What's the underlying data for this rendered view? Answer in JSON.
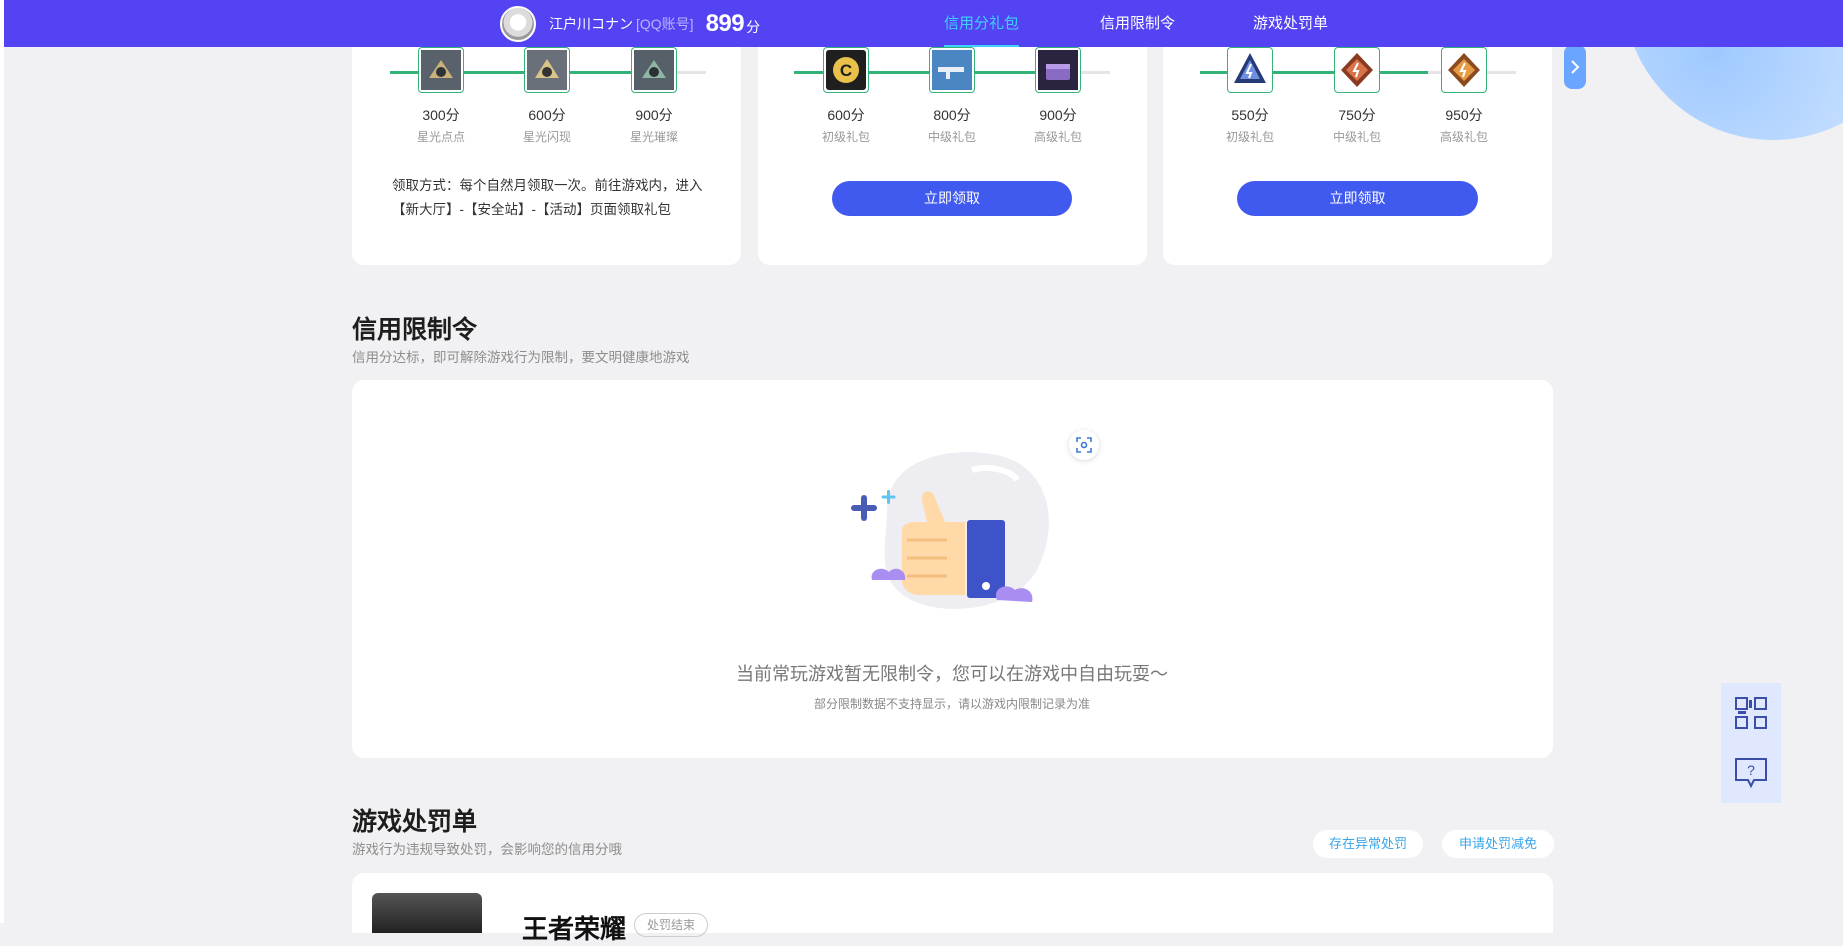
{
  "header": {
    "username": "江户川コナン",
    "account_type": "[QQ账号]",
    "score": "899",
    "score_unit": "分",
    "tabs": [
      {
        "label": "信用分礼包",
        "active": true
      },
      {
        "label": "信用限制令",
        "active": false
      },
      {
        "label": "游戏处罚单",
        "active": false
      }
    ]
  },
  "gift_cards": [
    {
      "progress": 0.85,
      "rewards": [
        {
          "points": "300分",
          "name": "星光点点",
          "icon": "drone-icon"
        },
        {
          "points": "600分",
          "name": "星光闪现",
          "icon": "drone-icon"
        },
        {
          "points": "900分",
          "name": "星光璀璨",
          "icon": "drone-icon"
        }
      ],
      "note": "领取方式：每个自然月领取一次。前往游戏内，进入【新大厅】-【安全站】-【活动】页面领取礼包"
    },
    {
      "progress": 0.9,
      "rewards": [
        {
          "points": "600分",
          "name": "初级礼包",
          "icon": "coin-icon"
        },
        {
          "points": "800分",
          "name": "中级礼包",
          "icon": "gun-icon"
        },
        {
          "points": "900分",
          "name": "高级礼包",
          "icon": "chest-icon"
        }
      ],
      "button": "立即领取"
    },
    {
      "progress": 0.72,
      "rewards": [
        {
          "points": "550分",
          "name": "初级礼包",
          "icon": "badge-icon"
        },
        {
          "points": "750分",
          "name": "中级礼包",
          "icon": "badge-icon"
        },
        {
          "points": "950分",
          "name": "高级礼包",
          "icon": "badge-icon"
        }
      ],
      "button": "立即领取"
    }
  ],
  "restriction": {
    "title": "信用限制令",
    "subtitle": "信用分达标，即可解除游戏行为限制，要文明健康地游戏",
    "empty_message": "当前常玩游戏暂无限制令，您可以在游戏中自由玩耍～",
    "empty_note": "部分限制数据不支持显示，请以游戏内限制记录为准"
  },
  "penalty": {
    "title": "游戏处罚单",
    "subtitle": "游戏行为违规导致处罚，会影响您的信用分哦",
    "btn_abnormal": "存在异常处罚",
    "btn_reduce": "申请处罚减免",
    "game_name": "王者荣耀",
    "game_status": "处罚结束"
  },
  "colors": {
    "header": "#5343f2",
    "accent_tab": "#3fd2ff",
    "button": "#4059ef",
    "progress": "#33b377"
  }
}
